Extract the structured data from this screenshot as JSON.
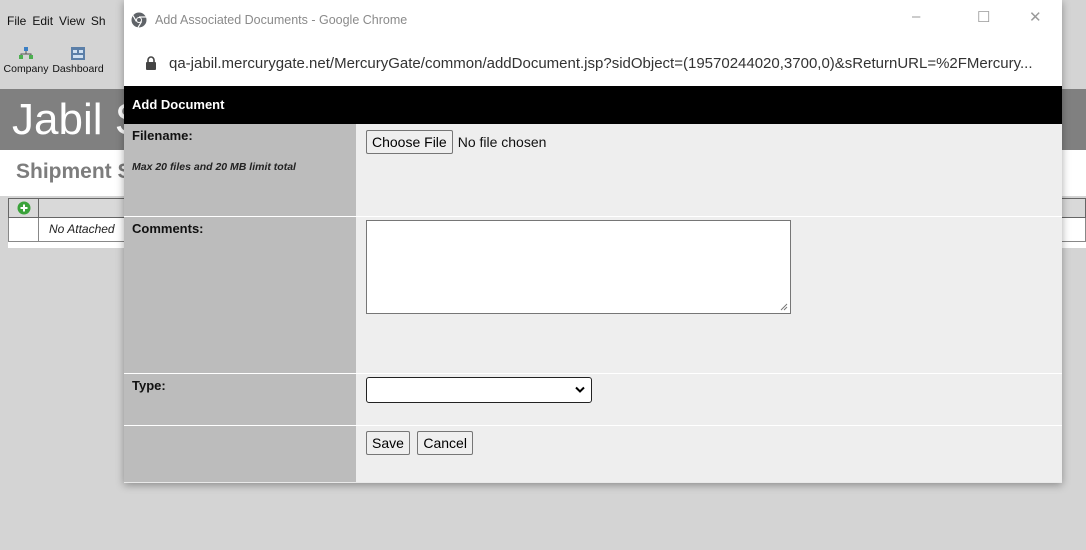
{
  "background_app": {
    "menu": [
      "File",
      "Edit",
      "View",
      "Sh"
    ],
    "toolbar": [
      {
        "label": "Company",
        "icon": "company-icon"
      },
      {
        "label": "Dashboard",
        "icon": "dashboard-icon"
      }
    ],
    "title": "Jabil S",
    "subtitle": "Shipment S",
    "table": {
      "empty_text": "No Attached"
    }
  },
  "popup": {
    "window_title": "Add Associated Documents - Google Chrome",
    "controls": {
      "minimize": "–",
      "maximize": "☐",
      "close": "✕"
    },
    "url": "qa-jabil.mercurygate.net/MercuryGate/common/addDocument.jsp?sidObject=(19570244020,3700,0)&sReturnURL=%2FMercury...",
    "header": "Add Document",
    "form": {
      "filename_label": "Filename:",
      "filename_note": "Max 20 files and 20 MB limit total",
      "choose_file_label": "Choose File",
      "file_status": "No file chosen",
      "comments_label": "Comments:",
      "comments_value": "",
      "type_label": "Type:",
      "type_value": "",
      "save_label": "Save",
      "cancel_label": "Cancel"
    }
  },
  "colors": {
    "header_bg": "#000000",
    "label_bg": "#bcbcbc",
    "value_bg": "#eeeeee",
    "app_title_bg": "#808080"
  }
}
